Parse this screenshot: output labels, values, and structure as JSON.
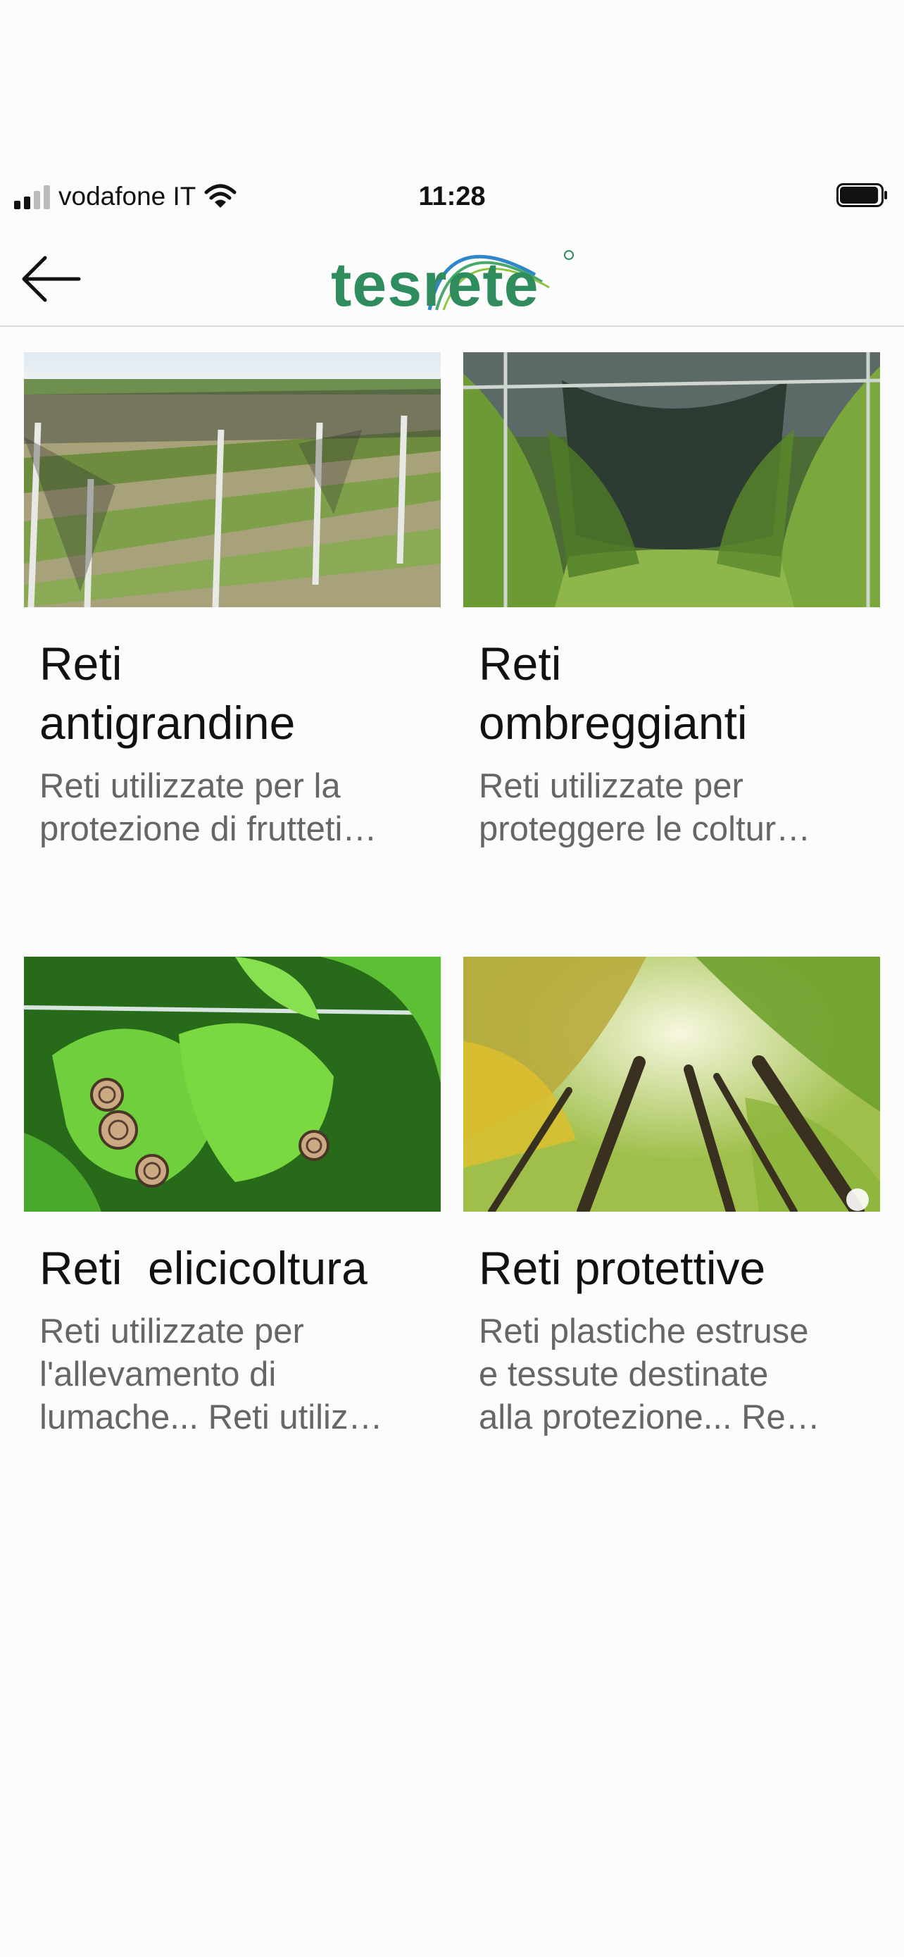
{
  "status_bar": {
    "carrier": "vodafone IT",
    "time": "11:28",
    "signal_bars": 2,
    "battery_level": 0.95
  },
  "header": {
    "back_icon": "arrow-left-icon",
    "logo_text": "tesrete",
    "brand_color": "#2e8c5d"
  },
  "products": [
    {
      "title": "Reti\nantigrandine",
      "description": "Reti utilizzate per la\nprotezione di frutteti…",
      "image": "orchard-hail-nets-photo"
    },
    {
      "title": "Reti\nombreggianti",
      "description": "Reti utilizzate per\nproteggere le coltur…",
      "image": "shade-net-orchard-photo"
    },
    {
      "title": "Reti  elicicoltura",
      "description": "Reti utilizzate per\nl'allevamento di\nlumache... Reti utiliz…",
      "image": "snails-on-leaves-photo"
    },
    {
      "title": "Reti protettive",
      "description": "Reti plastiche estruse\ne tessute destinate\nalla protezione... Re…",
      "image": "forest-canopy-photo"
    }
  ]
}
